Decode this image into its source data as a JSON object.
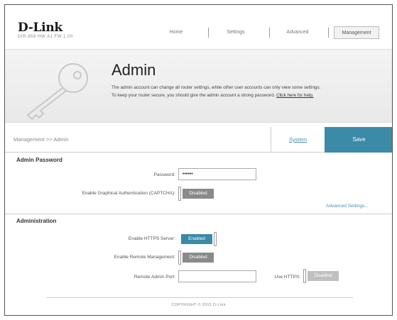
{
  "brand": {
    "logo": "D-Link",
    "model": "DIR-859  HW:A1  FW:1.00"
  },
  "nav": {
    "items": [
      {
        "label": "Home"
      },
      {
        "label": "Settings"
      },
      {
        "label": "Advanced"
      },
      {
        "label": "Management"
      }
    ],
    "active": "Management"
  },
  "banner": {
    "title": "Admin",
    "text_line1": "The admin account can change all router settings, while other user accounts can only view some settings.",
    "text_line2": "To keep your router secure, you should give the admin account a strong password.",
    "help_link": "Click here for help."
  },
  "breadcrumb": {
    "text": "Management >> Admin",
    "system_label": "System",
    "save_label": "Save"
  },
  "admin_password": {
    "section_title": "Admin Password",
    "password_label": "Password:",
    "password_value": "••••••",
    "captcha_label": "Enable Graphical Authentication (CAPTCHA):",
    "captcha_state": "Disabled",
    "advanced_link": "Advanced Settings..."
  },
  "administration": {
    "section_title": "Administration",
    "https_label": "Enable HTTPS Server:",
    "https_state": "Enabled",
    "remote_label": "Enable Remote Management:",
    "remote_state": "Disabled",
    "remote_port_label": "Remote Admin Port:",
    "remote_port_value": "",
    "use_https_label": "Use HTTPS:",
    "use_https_state": "Disabled"
  },
  "footer": {
    "copyright": "COPYRIGHT © 2015 D-Link"
  },
  "colors": {
    "accent": "#3a8aa8",
    "toggle_off": "#8a8a8a"
  }
}
